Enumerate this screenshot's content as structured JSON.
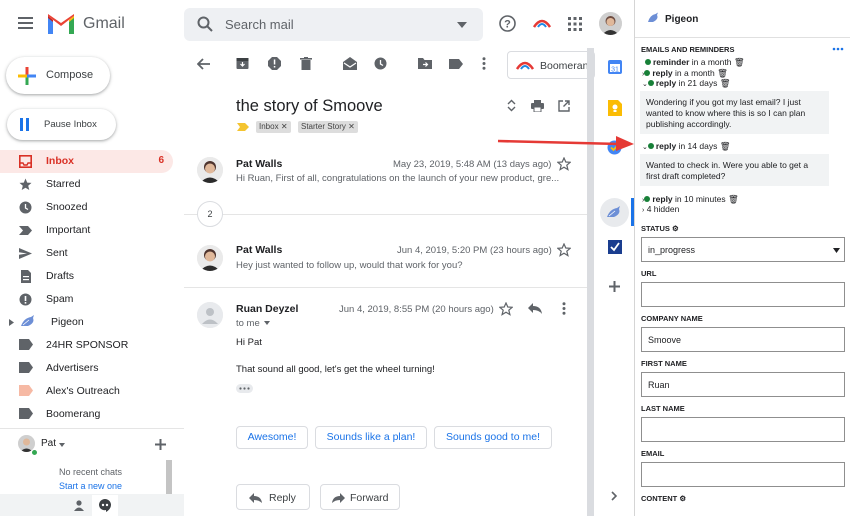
{
  "app": {
    "name": "Gmail"
  },
  "search": {
    "placeholder": "Search mail"
  },
  "compose": {
    "label": "Compose"
  },
  "pause_inbox": {
    "label": "Pause Inbox"
  },
  "nav": [
    {
      "id": "inbox",
      "label": "Inbox",
      "count": "6"
    },
    {
      "id": "starred",
      "label": "Starred"
    },
    {
      "id": "snoozed",
      "label": "Snoozed"
    },
    {
      "id": "important",
      "label": "Important"
    },
    {
      "id": "sent",
      "label": "Sent"
    },
    {
      "id": "drafts",
      "label": "Drafts"
    },
    {
      "id": "spam",
      "label": "Spam"
    },
    {
      "id": "pigeon",
      "label": "Pigeon"
    },
    {
      "id": "24hr",
      "label": "24HR SPONSOR"
    },
    {
      "id": "advertisers",
      "label": "Advertisers"
    },
    {
      "id": "alex",
      "label": "Alex's Outreach"
    },
    {
      "id": "boomerang",
      "label": "Boomerang"
    }
  ],
  "chat": {
    "user": "Pat",
    "no_chats": "No recent chats",
    "start_link": "Start a new one"
  },
  "toolbar": {
    "boomerang_label": "Boomerang"
  },
  "thread": {
    "subject": "the story of Smoove",
    "labels": [
      "Inbox",
      "Starter Story"
    ],
    "collapsed_count": "2",
    "messages": [
      {
        "sender": "Pat Walls",
        "date": "May 23, 2019, 5:48 AM (13 days ago)",
        "snippet": "Hi Ruan, First of all, congratulations on the launch of your new product, gre..."
      },
      {
        "sender": "Pat Walls",
        "date": "Jun 4, 2019, 5:20 PM (23 hours ago)",
        "snippet": "Hey just wanted to follow up, would that work for you?"
      },
      {
        "sender": "Ruan Deyzel",
        "date": "Jun 4, 2019, 8:55 PM (20 hours ago)",
        "to": "to me",
        "greeting": "Hi Pat",
        "body": "That sound all good, let's get the wheel turning!"
      }
    ],
    "suggestions": [
      "Awesome!",
      "Sounds like a plan!",
      "Sounds good to me!"
    ],
    "reply_label": "Reply",
    "forward_label": "Forward"
  },
  "pigeon": {
    "title": "Pigeon",
    "section": "EMAILS AND REMINDERS",
    "reminders": [
      {
        "kind": "reminder",
        "when": "in a month"
      },
      {
        "kind": "reply",
        "when": "in a month"
      },
      {
        "kind": "reply",
        "when": "in 21 days"
      }
    ],
    "card1": "Wondering if you got my last email? I just wanted to know where this is so I can plan publishing accordingly.",
    "reminder4": {
      "kind": "reply",
      "when": "in 14 days"
    },
    "card2": "Wanted to check in. Were you able to get a first draft completed?",
    "reminder5": {
      "kind": "reply",
      "when": "in 10 minutes"
    },
    "hidden": "4 hidden",
    "status_label": "STATUS",
    "status_value": "in_progress",
    "url_label": "URL",
    "url_value": "",
    "company_label": "COMPANY NAME",
    "company_value": "Smoove",
    "first_label": "FIRST NAME",
    "first_value": "Ruan",
    "last_label": "LAST NAME",
    "last_value": "",
    "email_label": "EMAIL",
    "email_value": "",
    "content_label": "CONTENT"
  },
  "colors": {
    "gmail_red": "#d93025",
    "link_blue": "#1a73e8",
    "pigeon_green": "#188038",
    "arrow_red": "#e53935"
  }
}
